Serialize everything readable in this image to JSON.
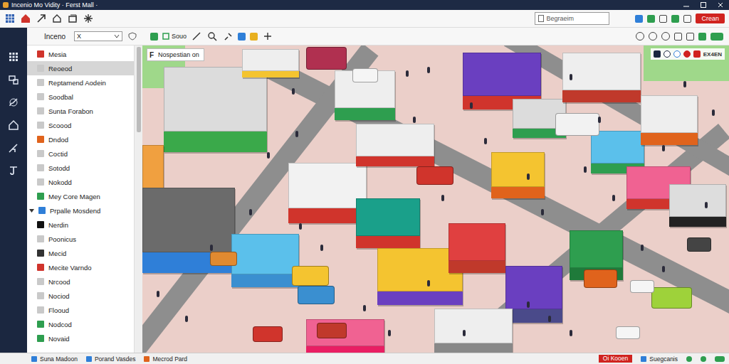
{
  "window": {
    "title": "Incenio Mo Vidity · Ferst Mall ·"
  },
  "toolbar": {
    "search": {
      "placeholder": "Begraeim"
    },
    "action": "Crean"
  },
  "panel": {
    "title": "Inceno",
    "filter": "X"
  },
  "tools": [
    {
      "label": "Souo"
    }
  ],
  "sidebar": {
    "items": [
      {
        "label": "Mesia",
        "kind": "item",
        "selected": false,
        "color": "#d0342c"
      },
      {
        "label": "Reoeod",
        "kind": "item",
        "selected": true,
        "color": "#c9c9c9"
      },
      {
        "label": "Reptamend Aodein",
        "kind": "item",
        "selected": false,
        "color": "#c9c9c9"
      },
      {
        "label": "Soodbal",
        "kind": "item",
        "selected": false,
        "color": "#c9c9c9"
      },
      {
        "label": "Sunta Forabon",
        "kind": "item",
        "selected": false,
        "color": "#c9c9c9"
      },
      {
        "label": "Scoood",
        "kind": "item",
        "selected": false,
        "color": "#c9c9c9"
      },
      {
        "label": "Dndod",
        "kind": "item",
        "selected": false,
        "color": "#e0631c"
      },
      {
        "label": "Coctid",
        "kind": "item",
        "selected": false,
        "color": "#c9c9c9"
      },
      {
        "label": "Sotodd",
        "kind": "item",
        "selected": false,
        "color": "#c9c9c9"
      },
      {
        "label": "Nokodd",
        "kind": "item",
        "selected": false,
        "color": "#c9c9c9"
      },
      {
        "label": "Mey Core Magen",
        "kind": "item",
        "selected": false,
        "color": "#2e9e4f"
      },
      {
        "label": "Prpalle Mosdend",
        "kind": "group",
        "selected": false,
        "expanded": true,
        "color": "#2f7fd8"
      },
      {
        "label": "Nerdin",
        "kind": "item",
        "selected": false,
        "color": "#111111"
      },
      {
        "label": "Poonicus",
        "kind": "item",
        "selected": false,
        "color": "#c9c9c9"
      },
      {
        "label": "Mecid",
        "kind": "item",
        "selected": false,
        "color": "#333333"
      },
      {
        "label": "Mecite Varndo",
        "kind": "item",
        "selected": false,
        "color": "#d0342c"
      },
      {
        "label": "Nrcood",
        "kind": "item",
        "selected": false,
        "color": "#c9c9c9"
      },
      {
        "label": "Nociod",
        "kind": "item",
        "selected": false,
        "color": "#c9c9c9"
      },
      {
        "label": "Flooud",
        "kind": "item",
        "selected": false,
        "color": "#c9c9c9"
      },
      {
        "label": "Nodcod",
        "kind": "item",
        "selected": false,
        "color": "#2e9e4f"
      },
      {
        "label": "Novaid",
        "kind": "item",
        "selected": false,
        "color": "#2e9e4f"
      }
    ]
  },
  "viewport": {
    "key": "F",
    "label": "Nospestian on",
    "badge": "EX4EN"
  },
  "status_bar": {
    "items": [
      "Suna Madoon",
      "Porand Vasdes",
      "Mecrod Pard"
    ],
    "alert": "Oi Kooen",
    "right": "Suegcanis"
  }
}
